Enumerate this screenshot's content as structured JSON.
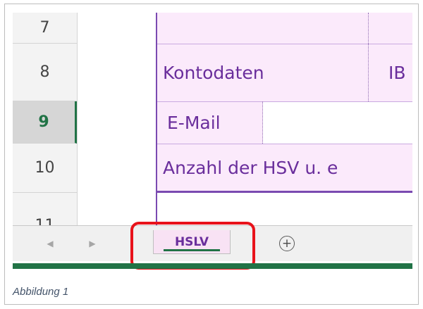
{
  "row_numbers": {
    "r7": "7",
    "r8": "8",
    "r9": "9",
    "r10": "10",
    "r11": "11"
  },
  "cells": {
    "kontodaten_label": "Kontodaten",
    "iban_label": "IB",
    "email_label": "E-Mail",
    "anzahl_label": "Anzahl der HSV u. e"
  },
  "sheet_tabs": {
    "active": "HSLV",
    "add_icon_glyph": "+",
    "prev_glyph": "◀",
    "next_glyph": "▶"
  },
  "caption": "Abbildung 1",
  "colors": {
    "accent_green": "#217346",
    "highlight_red": "#e8131b",
    "cell_fill": "#fbeafb",
    "text_purple": "#6a2e9c"
  }
}
